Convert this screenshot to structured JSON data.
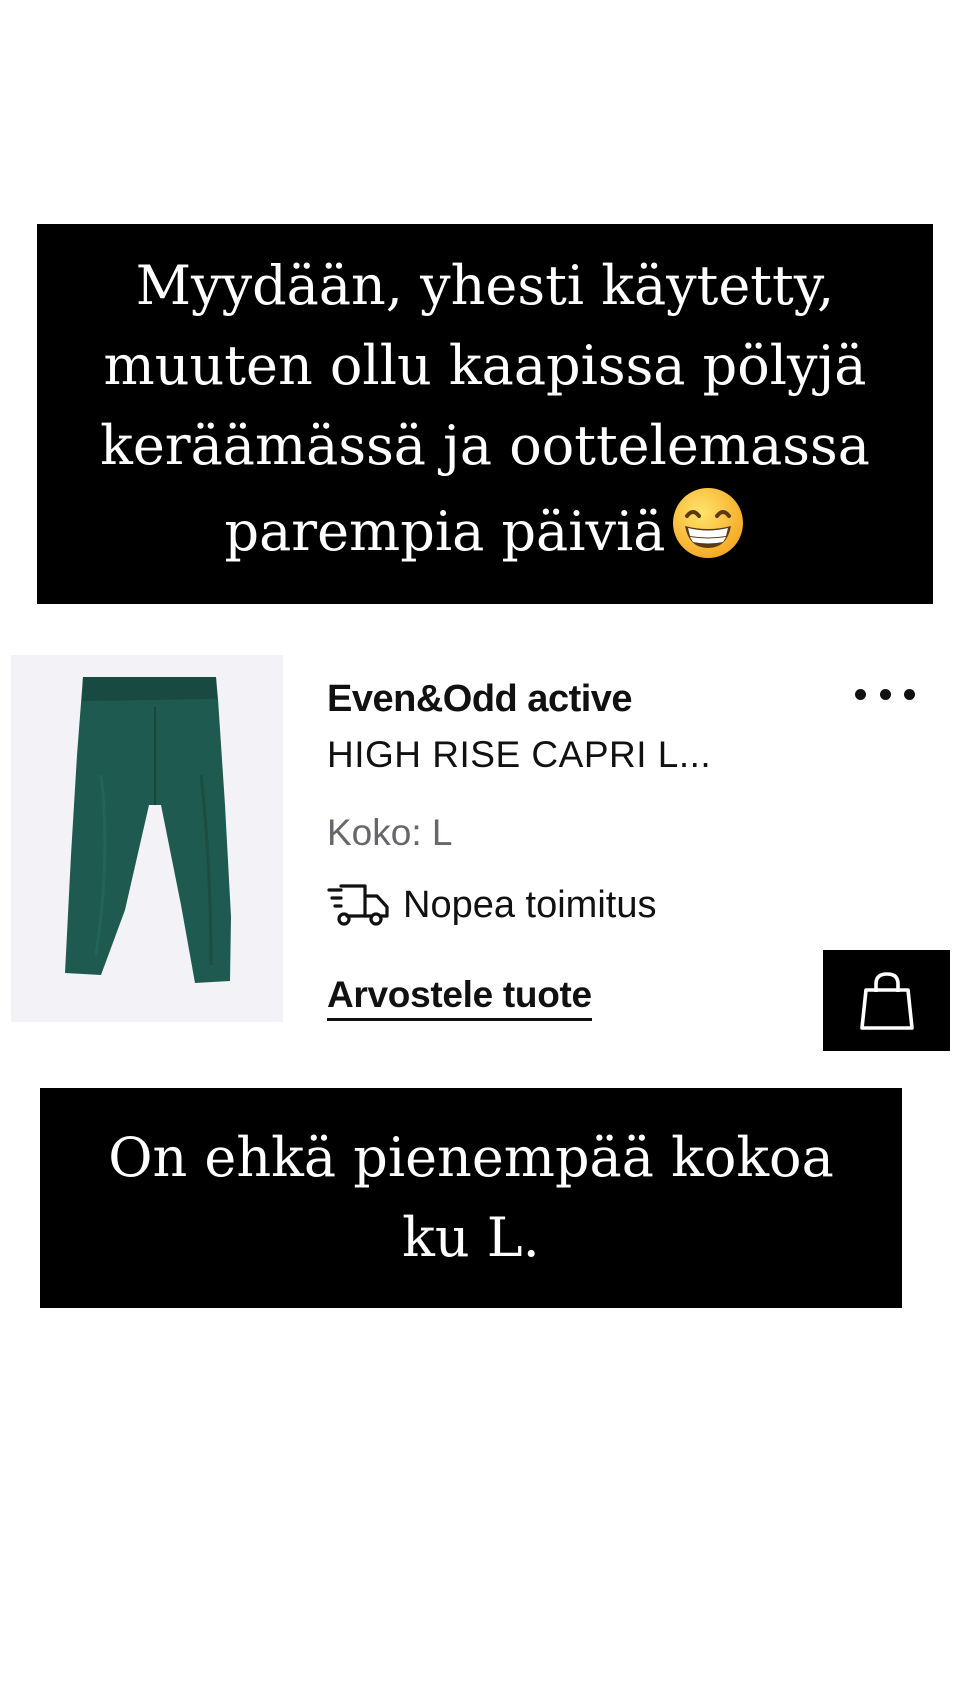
{
  "caption_top": {
    "lines": [
      "Myydään, yhesti käytetty,",
      "muuten ollu kaapissa pölyjä",
      "keräämässä ja oottelemassa",
      "parempia päiviä"
    ],
    "emoji": "grinning-face-with-smiling-eyes"
  },
  "product": {
    "image": "green-capri-leggings",
    "brand": "Even&Odd active",
    "name": "HIGH RISE CAPRI L...",
    "size": "Koko: L",
    "delivery_icon": "truck-icon",
    "delivery": "Nopea toimitus",
    "review_link": "Arvostele tuote",
    "more_icon": "more-dots-icon",
    "cart_icon": "shopping-bag-icon"
  },
  "caption_bottom": {
    "lines": [
      "On ehkä pienempää kokoa",
      "ku L."
    ]
  },
  "colors": {
    "caption_background": "#000000",
    "caption_text": "#ffffff",
    "product_green": "#1f5a50",
    "image_background": "#f3f3f7",
    "muted_text": "#66666c"
  }
}
